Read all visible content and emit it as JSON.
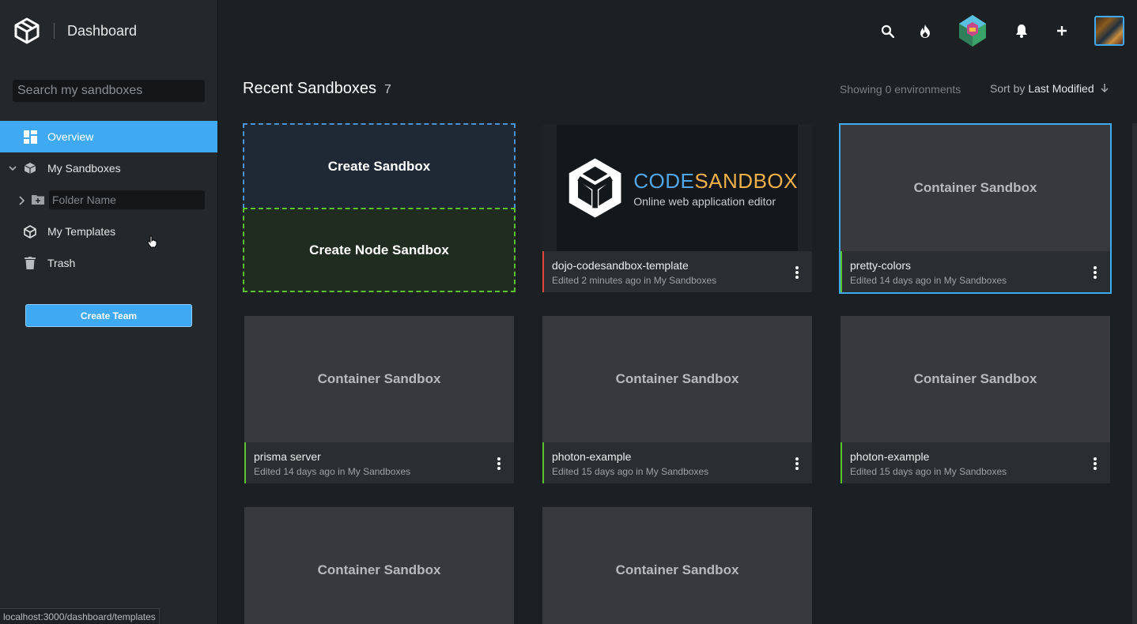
{
  "sidebar": {
    "title": "Dashboard",
    "search_placeholder": "Search my sandboxes",
    "items": [
      {
        "label": "Overview",
        "icon": "dashboard-icon"
      },
      {
        "label": "My Sandboxes",
        "icon": "cube-icon"
      },
      {
        "label": "My Templates",
        "icon": "cube-outline-icon"
      },
      {
        "label": "Trash",
        "icon": "trash-icon"
      }
    ],
    "folder_placeholder": "Folder Name",
    "create_team_label": "Create Team"
  },
  "header": {
    "section_title": "Recent Sandboxes",
    "section_count": "7",
    "showing": "Showing 0 environments",
    "sort_prefix": "Sort by",
    "sort_value": "Last Modified"
  },
  "create": {
    "sandbox_label": "Create Sandbox",
    "node_label": "Create Node Sandbox"
  },
  "codesandbox_logo": {
    "word_a": "CODE",
    "word_b": "SANDBOX",
    "tagline": "Online web application editor"
  },
  "cards": [
    {
      "name": "dojo-codesandbox-template",
      "meta": "Edited 2 minutes ago in My Sandboxes",
      "thumb": ""
    },
    {
      "name": "pretty-colors",
      "meta": "Edited 14 days ago in My Sandboxes",
      "thumb": "Container Sandbox"
    },
    {
      "name": "prisma server",
      "meta": "Edited 14 days ago in My Sandboxes",
      "thumb": "Container Sandbox"
    },
    {
      "name": "photon-example",
      "meta": "Edited 15 days ago in My Sandboxes",
      "thumb": "Container Sandbox"
    },
    {
      "name": "photon-example",
      "meta": "Edited 15 days ago in My Sandboxes",
      "thumb": "Container Sandbox"
    },
    {
      "name": "",
      "meta": "",
      "thumb": "Container Sandbox"
    },
    {
      "name": "",
      "meta": "",
      "thumb": "Container Sandbox"
    }
  ],
  "status_url": "localhost:3000/dashboard/templates",
  "colors": {
    "accent": "#40a9f3",
    "green": "#5cc330",
    "red": "#e0463c"
  }
}
